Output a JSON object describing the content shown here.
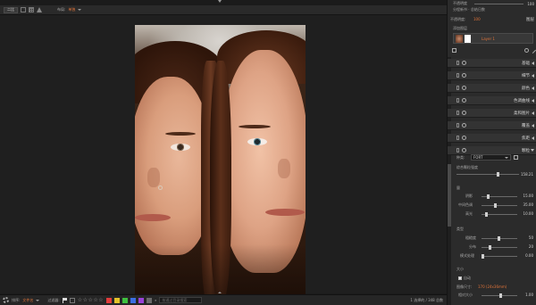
{
  "toolbar": {
    "mode_button": "二比",
    "layout_label": "布局:",
    "layout_value": "单独"
  },
  "status_bar": {
    "sort_label": "排序:",
    "sort_value": "文件名",
    "filter_label": "过滤器:",
    "stars": "☆☆☆☆☆",
    "search_placeholder": "按通过目录搜索",
    "count": "1 选择的 / 348 总数",
    "swatch_colors": [
      "#e23b3b",
      "#e3c22a",
      "#3fc03f",
      "#3b6fe2",
      "#9a42d8",
      "#6a6a6a"
    ]
  },
  "panel": {
    "top_value": "100",
    "top_label_1": "不透明度",
    "top_label_2": "分程新书 · 总结日数",
    "opacity_label": "不透明度:",
    "opacity_value": "100",
    "layers_title": "图层",
    "layer_add_label": "添加图层",
    "layer_name": "Layer 1",
    "sections": [
      "基础",
      "细节",
      "颜色",
      "色调曲线",
      "柔和图片",
      "覆盖",
      "焦距",
      "颗粒"
    ],
    "grain": {
      "type_label": "种类:",
      "type_value": "FORT",
      "amount_label": "综合颗粒强度",
      "amount_value": "158.21",
      "group_strength": "量",
      "shadows_label": "阴影",
      "shadows_value": "15.00",
      "midtones_label": "中间色调",
      "midtones_value": "35.00",
      "highlights_label": "高光",
      "highlights_value": "10.00",
      "group_type": "类型",
      "roughness_label": "粗糙度",
      "roughness_value": "50",
      "spread_label": "分布",
      "spread_value": "20",
      "blur_label": "模式处理",
      "blur_value": "0.00",
      "group_size": "大小",
      "auto_label": "自动",
      "resolution_label": "图像尺寸:",
      "resolution_value": "170 (24x36mm)",
      "relative_label": "相对大小",
      "relative_value": "1.00"
    }
  }
}
